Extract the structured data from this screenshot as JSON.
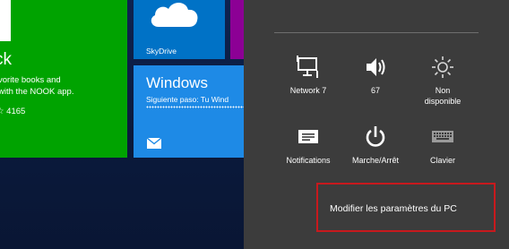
{
  "start_screen": {
    "nook_tile": {
      "title": "ck",
      "description_line1": "vorite books and",
      "description_line2": "with the NOOK app.",
      "rating": "☆ 4165",
      "color": "#00a300"
    },
    "skydrive_tile": {
      "label": "SkyDrive",
      "icon": "cloud-icon",
      "color": "#0072c6"
    },
    "windows_tile": {
      "title": "Windows",
      "subtitle": "Siguiente paso: Tu Wind",
      "icon": "mail-icon",
      "color": "#1e8ae6"
    },
    "purple_tile": {
      "color": "#8c0095"
    }
  },
  "settings_pane": {
    "background": "#3c3c3c",
    "quick_settings": [
      {
        "id": "network",
        "icon": "network-icon",
        "label": "Network  7"
      },
      {
        "id": "volume",
        "icon": "speaker-icon",
        "label": "67"
      },
      {
        "id": "brightness",
        "icon": "sun-icon",
        "label_line1": "Non",
        "label_line2": "disponible"
      },
      {
        "id": "notifications",
        "icon": "notifications-icon",
        "label": "Notifications"
      },
      {
        "id": "power",
        "icon": "power-icon",
        "label": "Marche/Arrêt"
      },
      {
        "id": "keyboard",
        "icon": "keyboard-icon",
        "label": "Clavier"
      }
    ],
    "change_pc_settings": {
      "label": "Modifier les paramètres du PC",
      "highlight_color": "#c8191d"
    }
  }
}
